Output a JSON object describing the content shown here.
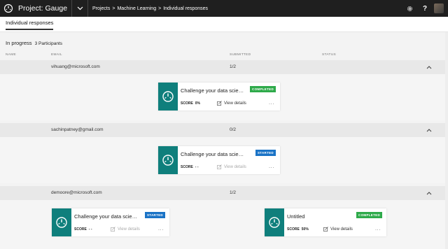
{
  "topbar": {
    "project_title": "Project: Gauge",
    "breadcrumb": [
      "Projects",
      ">",
      "Machine Learning",
      ">",
      "Individual responses"
    ],
    "help_label": "?"
  },
  "tabs": [
    {
      "label": "Individual responses"
    }
  ],
  "status": {
    "state": "In progress",
    "participants": "3 Participants"
  },
  "columns": {
    "name": "NAME",
    "email": "EMAIL",
    "submitted": "SUBMITTED",
    "status": "STATUS"
  },
  "groups": [
    {
      "email": "vihuang@microsoft.com",
      "submitted": "1/2",
      "cards": [
        {
          "title": "Challenge your data scien...",
          "badge": "COMPLETED",
          "score_label": "SCORE",
          "score": "0%",
          "view": "View details",
          "more": "..."
        }
      ]
    },
    {
      "email": "sachinpatney@gmail.com",
      "submitted": "0/2",
      "cards": [
        {
          "title": "Challenge your data scien...",
          "badge": "STARTED",
          "score_label": "SCORE",
          "score": "- -",
          "view": "View details",
          "more": "..."
        }
      ]
    },
    {
      "email": "demoore@microsoft.com",
      "submitted": "1/2",
      "cards": [
        {
          "title": "Challenge your data scien...",
          "badge": "STARTED",
          "score_label": "SCORE",
          "score": "- -",
          "view": "View details",
          "more": "..."
        },
        {
          "title": "Untitled",
          "badge": "COMPLETED",
          "score_label": "SCORE",
          "score": "50%",
          "view": "View details",
          "more": "..."
        }
      ]
    }
  ],
  "colors": {
    "topbar": "#1f1f1f",
    "thumb": "#0f7f7c",
    "completed": "#2eaa4a",
    "started": "#1a73c6"
  }
}
